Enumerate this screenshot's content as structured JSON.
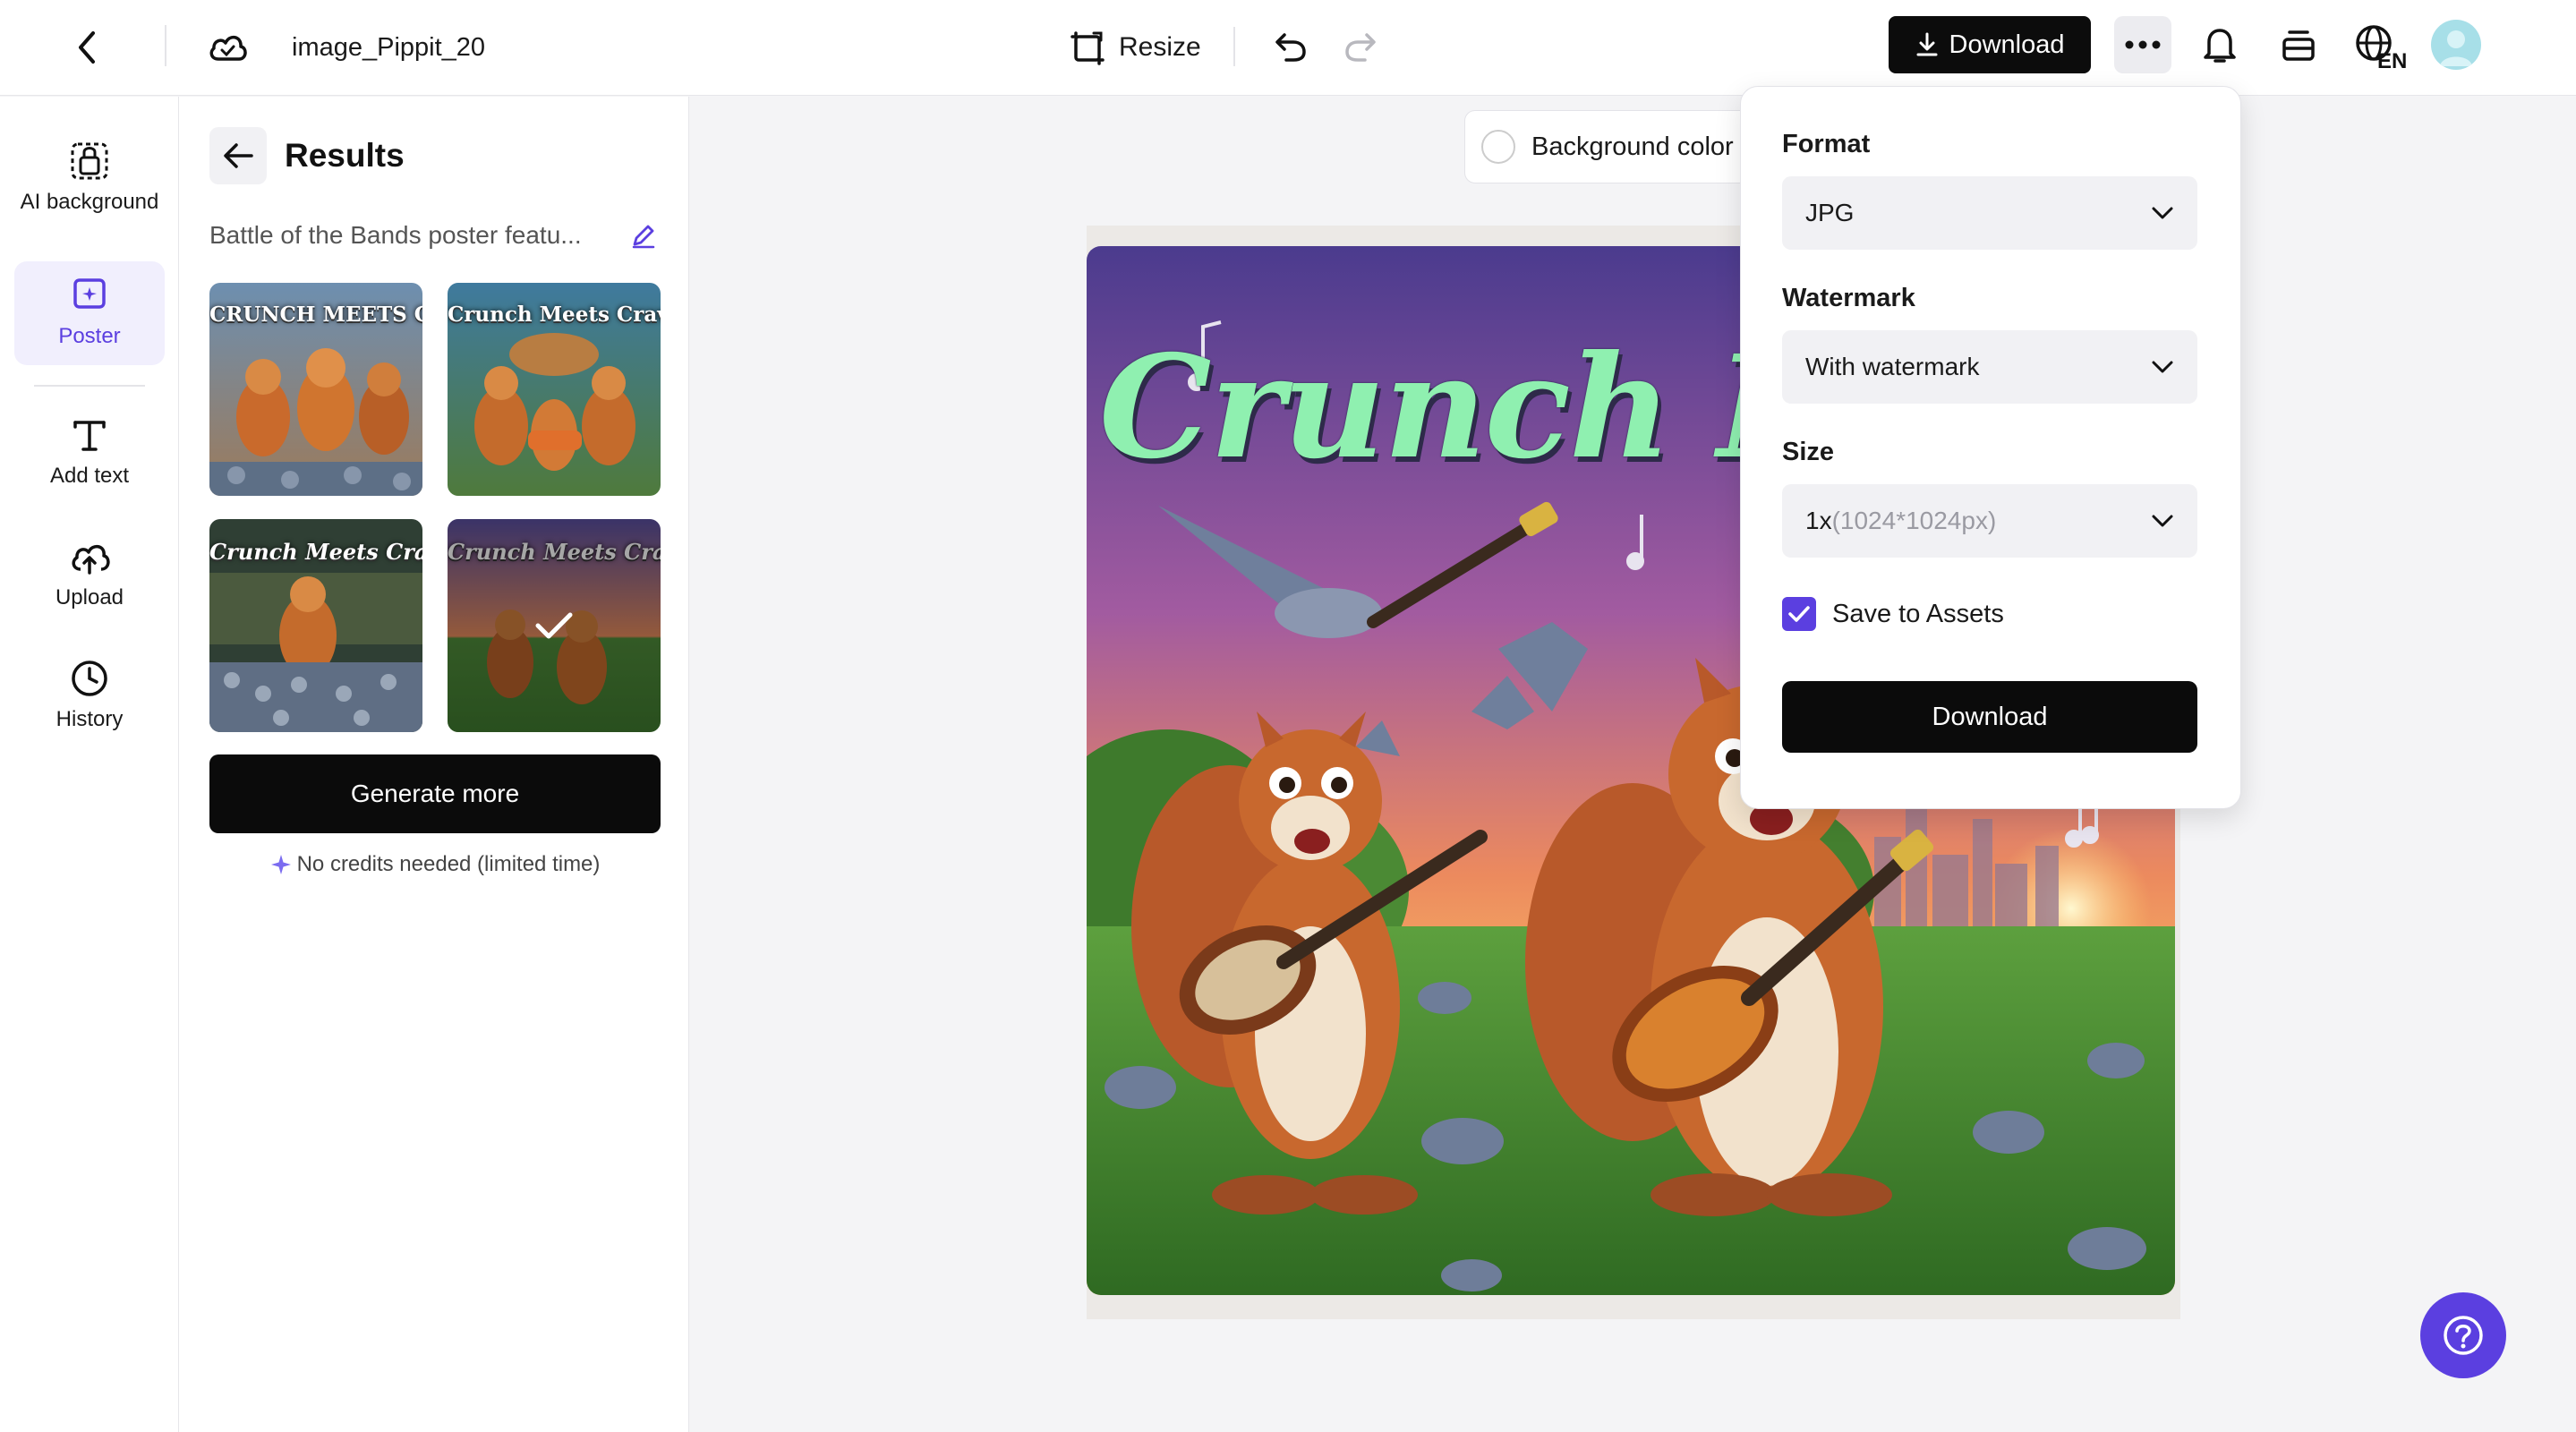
{
  "header": {
    "doc_title": "image_Pippit_20",
    "resize_label": "Resize",
    "download_label": "Download",
    "language_code": "EN"
  },
  "rail": {
    "items": [
      {
        "label": "AI background",
        "icon": "ai-background-icon"
      },
      {
        "label": "Poster",
        "icon": "poster-icon",
        "active": true
      },
      {
        "label": "Add text",
        "icon": "text-icon"
      },
      {
        "label": "Upload",
        "icon": "upload-icon"
      },
      {
        "label": "History",
        "icon": "history-icon"
      }
    ]
  },
  "results": {
    "title": "Results",
    "prompt": "Battle of the Bands poster featu...",
    "thumbnails": [
      {
        "title": "CRUNCH MEETS CRAVE",
        "selected": false
      },
      {
        "title": "Crunch Meets Crave",
        "selected": false
      },
      {
        "title": "Crunch Meets Crave",
        "selected": false
      },
      {
        "title": "Crunch Meets Crave",
        "selected": true
      }
    ],
    "generate_label": "Generate more",
    "credits_note": "No credits needed (limited time)"
  },
  "canvas": {
    "background_color_label": "Background color",
    "poster_title": "Crunch Meet"
  },
  "download_panel": {
    "format_label": "Format",
    "format_value": "JPG",
    "watermark_label": "Watermark",
    "watermark_value": "With watermark",
    "size_label": "Size",
    "size_scale": "1x",
    "size_px": "(1024*1024px)",
    "save_to_assets_label": "Save to Assets",
    "save_to_assets_checked": true,
    "download_button": "Download"
  },
  "colors": {
    "accent": "#5b3fe0",
    "primary_button": "#0b0b0b",
    "active_rail_bg": "#f1effd"
  }
}
